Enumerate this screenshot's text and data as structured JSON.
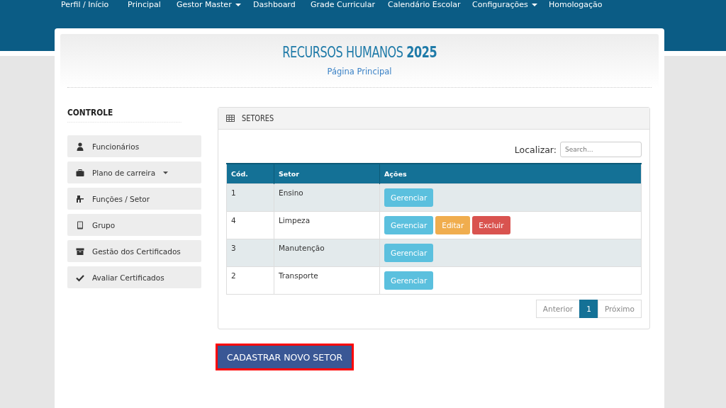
{
  "nav": [
    {
      "label": "Perfil / Início",
      "dropdown": false
    },
    {
      "label": "Principal",
      "dropdown": false
    },
    {
      "label": "Gestor Master",
      "dropdown": true
    },
    {
      "label": "Dashboard",
      "dropdown": false
    },
    {
      "label": "Grade Curricular",
      "dropdown": false
    },
    {
      "label": "Calendário Escolar",
      "dropdown": false
    },
    {
      "label": "Configurações",
      "dropdown": true
    },
    {
      "label": "Homologação",
      "dropdown": false
    }
  ],
  "header": {
    "title": "RECURSOS HUMANOS **2025**",
    "subtitle": "Página Principal"
  },
  "sidebar": {
    "title": "CONTROLE",
    "items": [
      {
        "label": "Funcionários",
        "dropdown": false
      },
      {
        "label": "Plano de carreira",
        "dropdown": true
      },
      {
        "label": "Funções / Setor",
        "dropdown": false
      },
      {
        "label": "Grupo",
        "dropdown": false
      },
      {
        "label": "Gestão dos Certificados",
        "dropdown": false
      },
      {
        "label": "Avaliar Certificados",
        "dropdown": false
      }
    ]
  },
  "panel": {
    "title": "SETORES",
    "search_label": "Localizar:",
    "search_placeholder": "Search...",
    "columns": [
      "Cód.",
      "Setor",
      "Ações"
    ],
    "rows": [
      {
        "code": "1",
        "name": "Ensino",
        "actions": [
          {
            "label": "Gerenciar",
            "kind": "manage"
          }
        ]
      },
      {
        "code": "4",
        "name": "Limpeza",
        "actions": [
          {
            "label": "Gerenciar",
            "kind": "manage"
          },
          {
            "label": "Editar",
            "kind": "edit"
          },
          {
            "label": "Excluir",
            "kind": "delete"
          }
        ]
      },
      {
        "code": "3",
        "name": "Manutenção",
        "actions": [
          {
            "label": "Gerenciar",
            "kind": "manage"
          }
        ]
      },
      {
        "code": "2",
        "name": "Transporte",
        "actions": [
          {
            "label": "Gerenciar",
            "kind": "manage"
          }
        ]
      }
    ],
    "pagination": [
      {
        "label": "Anterior",
        "selected": false
      },
      {
        "label": "1",
        "selected": true
      },
      {
        "label": "Próximo",
        "selected": false
      }
    ]
  },
  "add_button": {
    "label": "CADASTRAR NOVO SETOR",
    "highlighted": true
  }
}
